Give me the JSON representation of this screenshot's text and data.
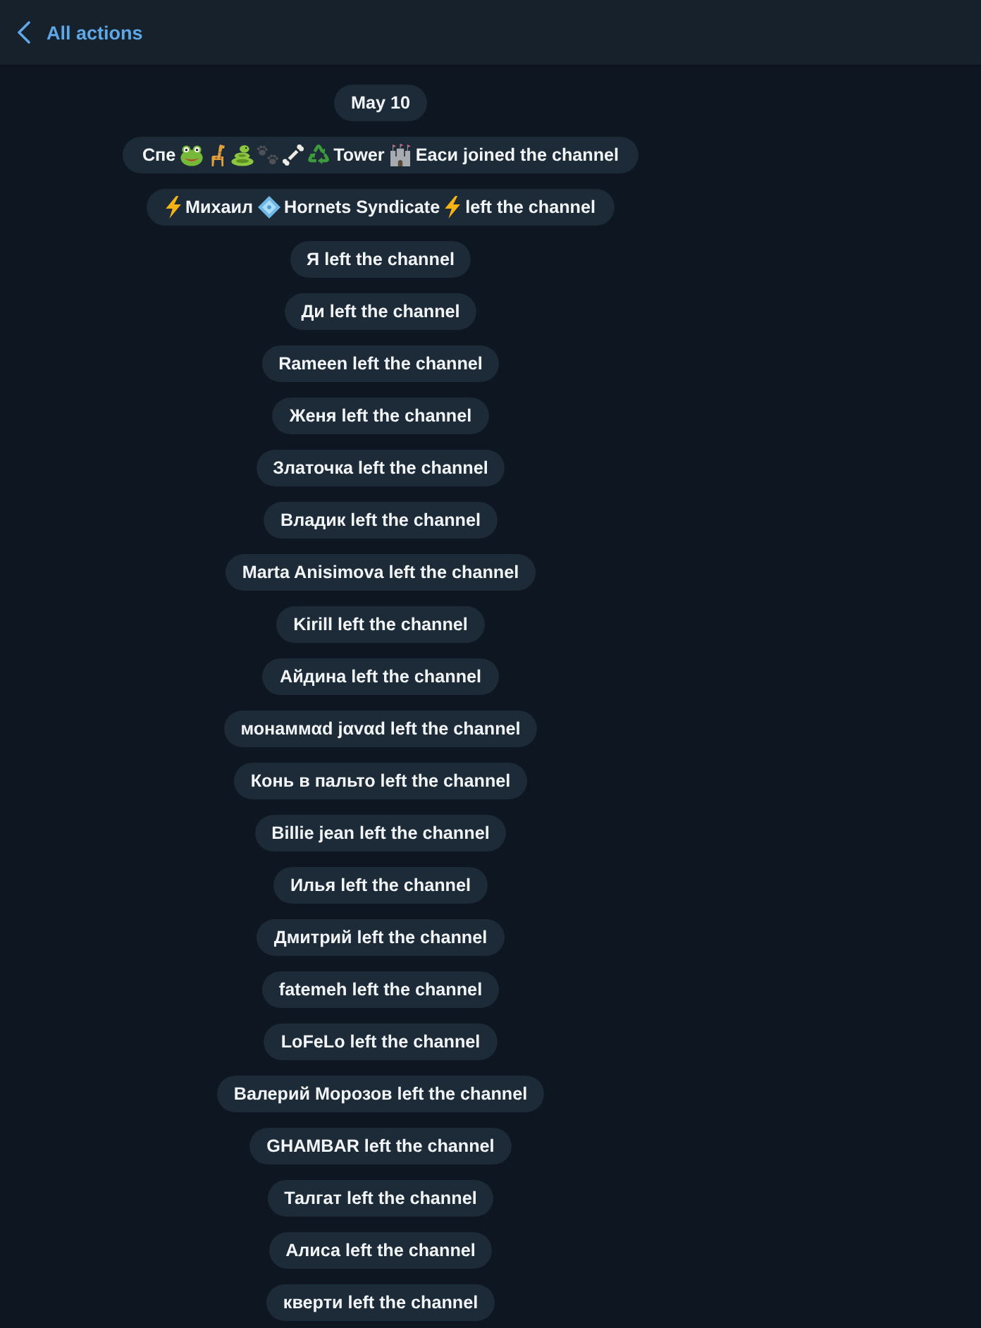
{
  "header": {
    "title": "All actions"
  },
  "date": "May 10",
  "events": [
    {
      "parts": [
        {
          "kind": "text",
          "text": "Спе"
        },
        {
          "kind": "frog"
        },
        {
          "kind": "giraffe"
        },
        {
          "kind": "snake"
        },
        {
          "kind": "paws"
        },
        {
          "kind": "bone"
        },
        {
          "kind": "recycle"
        },
        {
          "kind": "text",
          "text": "Tower"
        },
        {
          "kind": "castle"
        },
        {
          "kind": "text",
          "text": "Еаси joined the channel"
        }
      ]
    },
    {
      "parts": [
        {
          "kind": "lightning"
        },
        {
          "kind": "text",
          "text": "Михаил"
        },
        {
          "kind": "diamond"
        },
        {
          "kind": "text",
          "text": "Hornets Syndicate"
        },
        {
          "kind": "lightning"
        },
        {
          "kind": "text",
          "text": "left the channel"
        }
      ]
    },
    {
      "text": "Я left the channel"
    },
    {
      "text": "Ди left the channel"
    },
    {
      "text": "Rameen left the channel"
    },
    {
      "text": "Женя left the channel"
    },
    {
      "text": "Златочка left the channel"
    },
    {
      "text": "Владик left the channel"
    },
    {
      "text": "Marta Anisimova left the channel"
    },
    {
      "text": "Kirill left the channel"
    },
    {
      "text": "Айдина left the channel"
    },
    {
      "text": "монаммαd jαvαd left the channel"
    },
    {
      "text": "Конь в пальто left the channel"
    },
    {
      "text": "Billie jean left the channel"
    },
    {
      "text": "Илья left the channel"
    },
    {
      "text": "Дмитрий left the channel"
    },
    {
      "text": "fatemeh left the channel"
    },
    {
      "text": "LoFeLo left the channel"
    },
    {
      "text": "Валерий Морозов left the channel"
    },
    {
      "text": "GHAMBAR left the channel"
    },
    {
      "text": "Талгат left the channel"
    },
    {
      "text": "Алиса left the channel"
    },
    {
      "text": "кверти left the channel"
    }
  ]
}
